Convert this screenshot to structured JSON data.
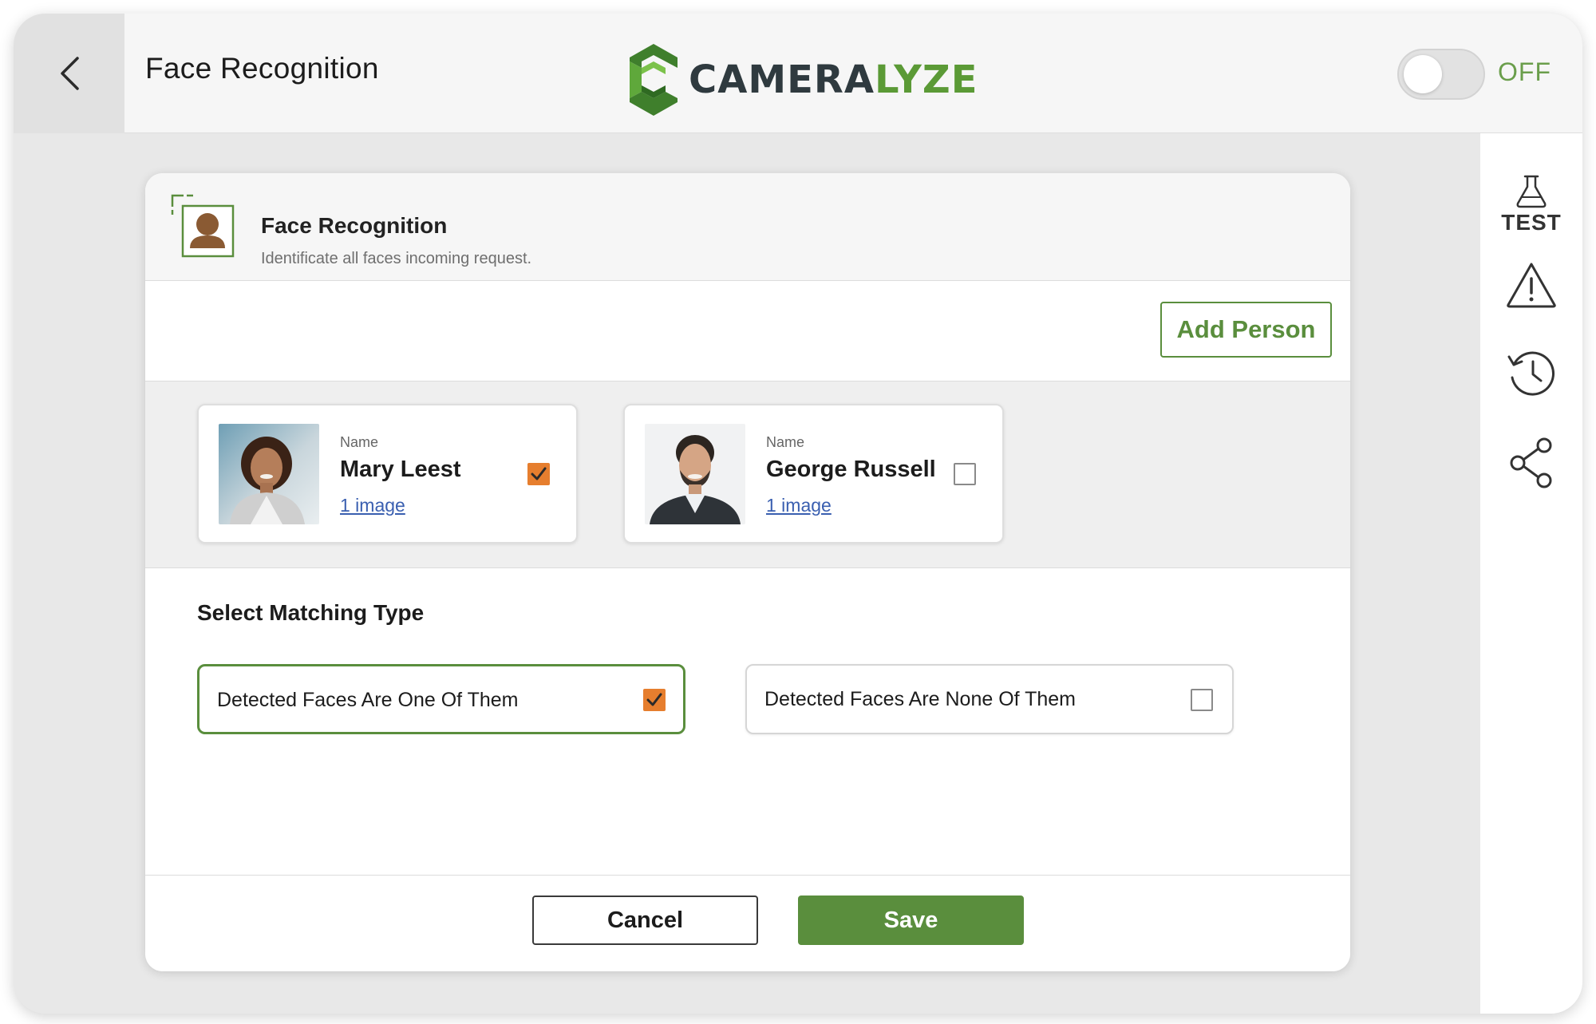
{
  "header": {
    "title": "Face Recognition",
    "logo_main": "CAMERA",
    "logo_accent": "LYZE",
    "toggle_state": "OFF"
  },
  "sidebar": {
    "test_label": "TEST",
    "items": [
      "flask-icon",
      "warning-icon",
      "history-icon",
      "share-icon"
    ]
  },
  "card": {
    "title": "Face Recognition",
    "subtitle": "Identificate all faces incoming request.",
    "add_person_label": "Add Person"
  },
  "people": [
    {
      "label": "Name",
      "name": "Mary Leest",
      "images_link": "1 image",
      "checked": true
    },
    {
      "label": "Name",
      "name": "George Russell",
      "images_link": "1 image",
      "checked": false
    }
  ],
  "matching": {
    "title": "Select Matching Type",
    "options": [
      {
        "label": "Detected Faces Are One Of Them",
        "checked": true
      },
      {
        "label": "Detected Faces Are None Of Them",
        "checked": false
      }
    ]
  },
  "footer": {
    "cancel_label": "Cancel",
    "save_label": "Save"
  },
  "colors": {
    "brand_green": "#5a8e3d",
    "checkbox_orange": "#e67e2e",
    "link_blue": "#3a5fb0"
  }
}
